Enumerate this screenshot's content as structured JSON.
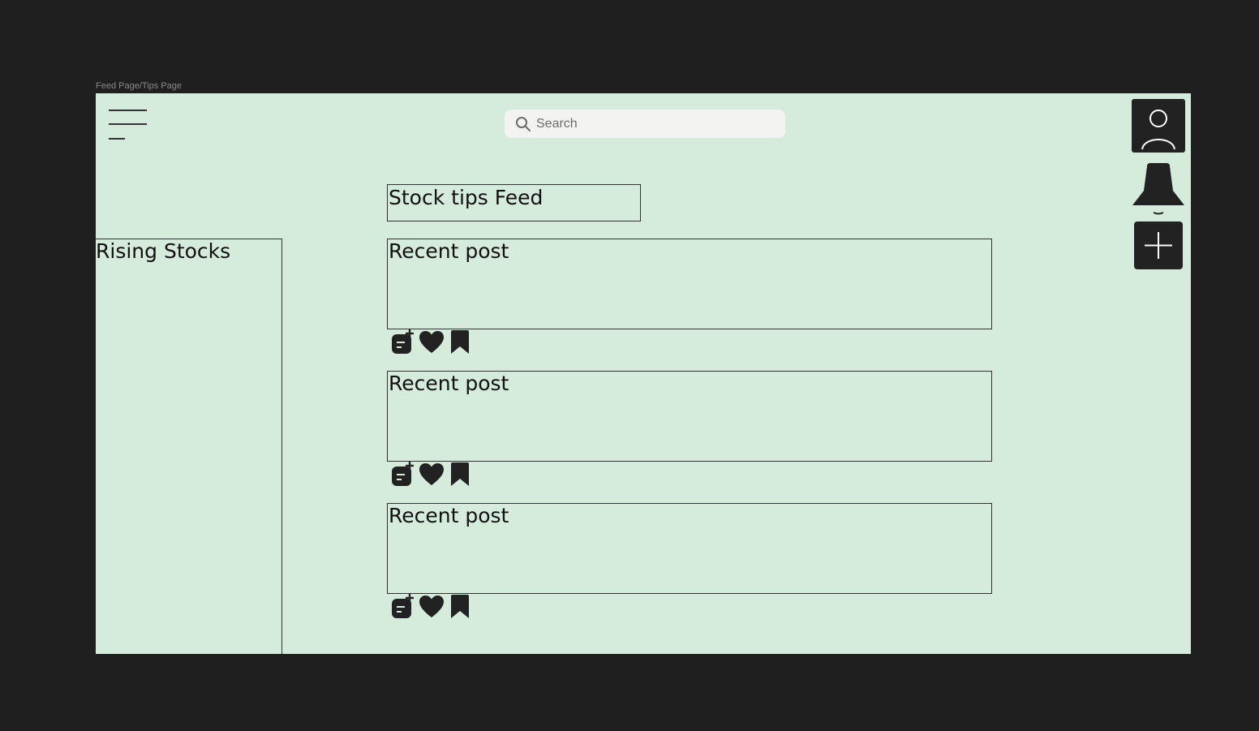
{
  "frame": {
    "label": "Feed Page/Tips Page",
    "background": "#d5ebdc"
  },
  "header": {
    "menu_icon": "hamburger-menu-icon",
    "search": {
      "placeholder": "Search",
      "icon": "search-icon"
    },
    "actions": [
      {
        "name": "profile",
        "icon": "user-icon"
      },
      {
        "name": "notifications",
        "icon": "bell-icon"
      },
      {
        "name": "new-post",
        "icon": "plus-icon"
      }
    ]
  },
  "feed": {
    "title": "Stock tips Feed",
    "posts": [
      {
        "title": "Recent post",
        "actions": [
          "comment-add-icon",
          "heart-icon",
          "bookmark-icon"
        ]
      },
      {
        "title": "Recent post",
        "actions": [
          "comment-add-icon",
          "heart-icon",
          "bookmark-icon"
        ]
      },
      {
        "title": "Recent post",
        "actions": [
          "comment-add-icon",
          "heart-icon",
          "bookmark-icon"
        ]
      }
    ]
  },
  "sidebar": {
    "title": "Rising Stocks"
  },
  "colors": {
    "page_bg": "#1f1f1f",
    "frame_bg": "#d5ebdc",
    "icon_dark": "#222222",
    "search_bg": "#f3f4f2"
  }
}
